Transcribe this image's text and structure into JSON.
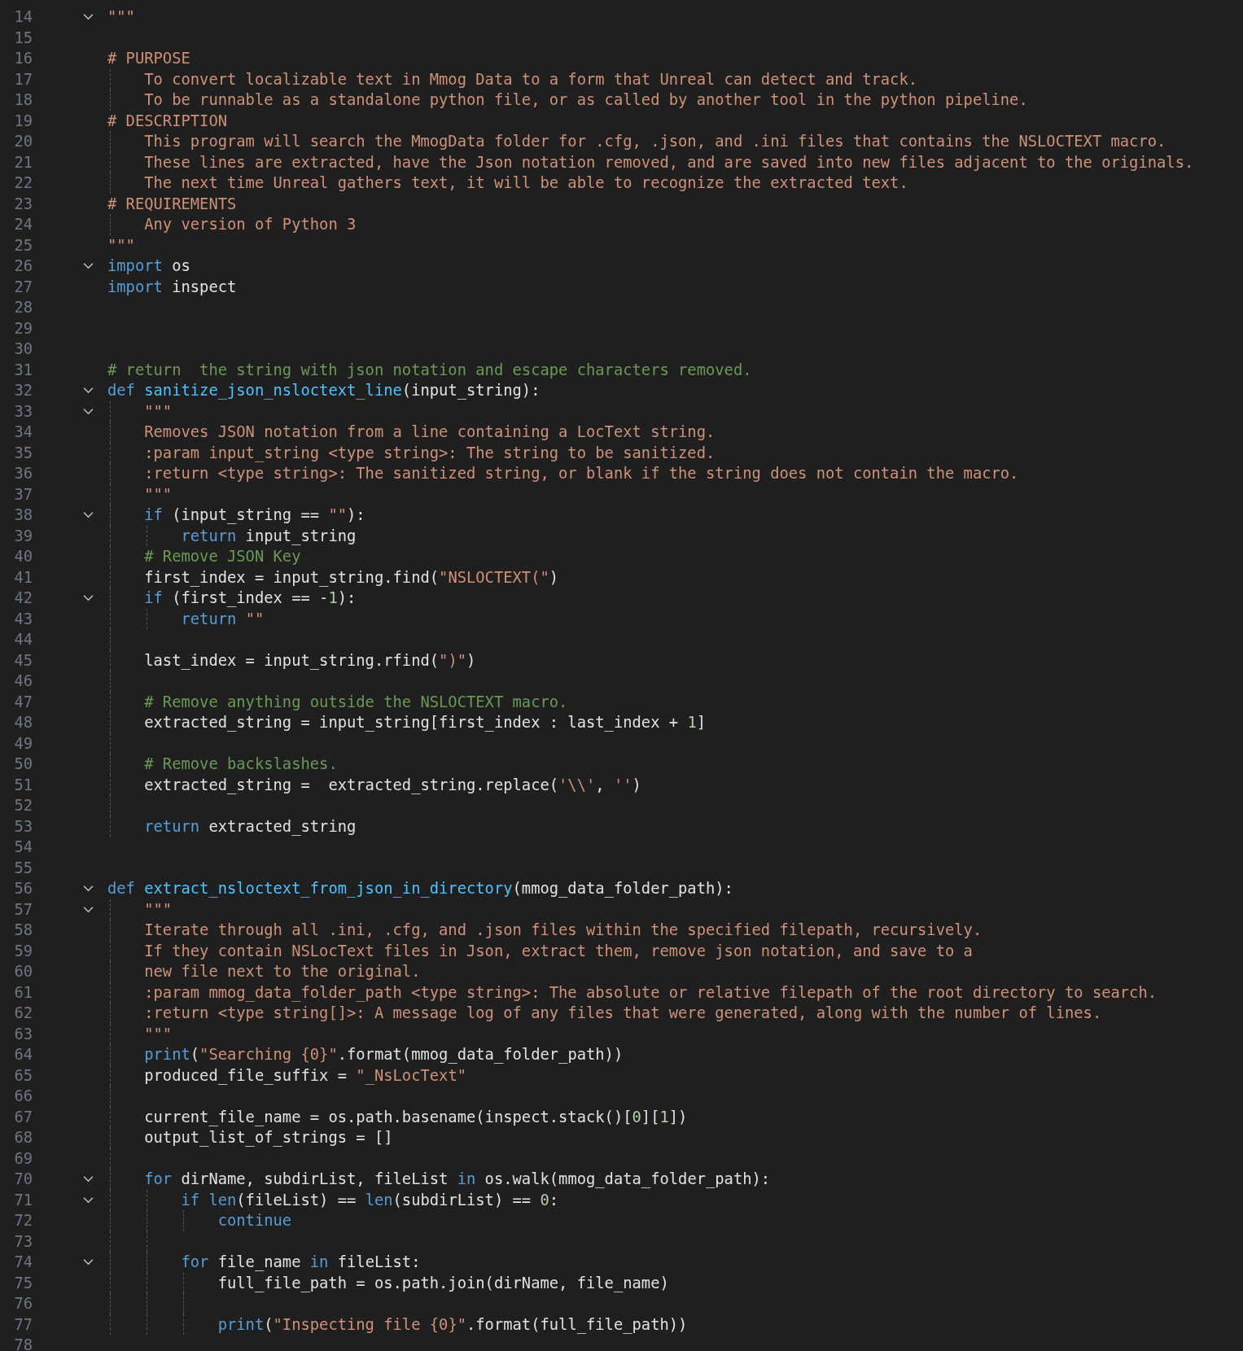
{
  "editor": {
    "lines": [
      {
        "number": "14",
        "folded": false,
        "tokens": [
          {
            "kind": "string",
            "text": "\"\"\""
          }
        ]
      },
      {
        "number": "15"
      },
      {
        "number": "16",
        "tokens": [
          {
            "kind": "string",
            "text": "# PURPOSE"
          }
        ]
      },
      {
        "number": "17",
        "tokens": [
          {
            "kind": "string",
            "text": "    To convert localizable text in Mmog Data to a form that Unreal can detect and track."
          }
        ]
      },
      {
        "number": "18",
        "tokens": [
          {
            "kind": "string",
            "text": "    To be runnable as a standalone python file, or as called by another tool in the python pipeline."
          }
        ]
      },
      {
        "number": "19",
        "tokens": [
          {
            "kind": "string",
            "text": "# DESCRIPTION"
          }
        ]
      },
      {
        "number": "20",
        "tokens": [
          {
            "kind": "string",
            "text": "    This program will search the MmogData folder for .cfg, .json, and .ini files that contains the NSLOCTEXT macro."
          }
        ]
      },
      {
        "number": "21",
        "tokens": [
          {
            "kind": "string",
            "text": "    These lines are extracted, have the Json notation removed, and are saved into new files adjacent to the originals."
          }
        ]
      },
      {
        "number": "22",
        "tokens": [
          {
            "kind": "string",
            "text": "    The next time Unreal gathers text, it will be able to recognize the extracted text."
          }
        ]
      },
      {
        "number": "23",
        "tokens": [
          {
            "kind": "string",
            "text": "# REQUIREMENTS"
          }
        ]
      },
      {
        "number": "24",
        "tokens": [
          {
            "kind": "string",
            "text": "    Any version of Python 3"
          }
        ]
      },
      {
        "number": "25",
        "tokens": [
          {
            "kind": "string",
            "text": "\"\"\""
          }
        ]
      },
      {
        "number": "26",
        "folded": false,
        "tokens": [
          {
            "kind": "keyword",
            "text": "import"
          },
          {
            "kind": "plain",
            "text": " os"
          }
        ]
      },
      {
        "number": "27",
        "tokens": [
          {
            "kind": "keyword",
            "text": "import"
          },
          {
            "kind": "plain",
            "text": " inspect"
          }
        ]
      },
      {
        "number": "28"
      },
      {
        "number": "29"
      },
      {
        "number": "30"
      },
      {
        "number": "31",
        "tokens": [
          {
            "kind": "comment",
            "text": "# return  the string with json notation and escape characters removed."
          }
        ]
      },
      {
        "number": "32",
        "folded": false,
        "tokens": [
          {
            "kind": "keyword",
            "text": "def "
          },
          {
            "kind": "function",
            "text": "sanitize_json_nsloctext_line"
          },
          {
            "kind": "plain",
            "text": "(input_string):"
          }
        ]
      },
      {
        "number": "33",
        "folded": false,
        "tokens": [
          {
            "kind": "string",
            "text": "    \"\"\""
          }
        ]
      },
      {
        "number": "34",
        "tokens": [
          {
            "kind": "string",
            "text": "    Removes JSON notation from a line containing a LocText string."
          }
        ]
      },
      {
        "number": "35",
        "tokens": [
          {
            "kind": "string",
            "text": "    :param input_string <type string>: The string to be sanitized."
          }
        ]
      },
      {
        "number": "36",
        "tokens": [
          {
            "kind": "string",
            "text": "    :return <type string>: The sanitized string, or blank if the string does not contain the macro."
          }
        ]
      },
      {
        "number": "37",
        "tokens": [
          {
            "kind": "string",
            "text": "    \"\"\""
          }
        ]
      },
      {
        "number": "38",
        "folded": false,
        "tokens": [
          {
            "kind": "keyword",
            "text": "    if"
          },
          {
            "kind": "plain",
            "text": " (input_string == "
          },
          {
            "kind": "string",
            "text": "\"\""
          },
          {
            "kind": "plain",
            "text": "):"
          }
        ]
      },
      {
        "number": "39",
        "tokens": [
          {
            "kind": "keyword",
            "text": "        return"
          },
          {
            "kind": "plain",
            "text": " input_string"
          }
        ]
      },
      {
        "number": "40",
        "tokens": [
          {
            "kind": "comment",
            "text": "    # Remove JSON Key"
          }
        ]
      },
      {
        "number": "41",
        "tokens": [
          {
            "kind": "plain",
            "text": "    first_index = input_string.find("
          },
          {
            "kind": "string",
            "text": "\"NSLOCTEXT(\""
          },
          {
            "kind": "plain",
            "text": ")"
          }
        ]
      },
      {
        "number": "42",
        "folded": false,
        "tokens": [
          {
            "kind": "keyword",
            "text": "    if"
          },
          {
            "kind": "plain",
            "text": " (first_index == -"
          },
          {
            "kind": "number",
            "text": "1"
          },
          {
            "kind": "plain",
            "text": "):"
          }
        ]
      },
      {
        "number": "43",
        "tokens": [
          {
            "kind": "keyword",
            "text": "        return "
          },
          {
            "kind": "string",
            "text": "\"\""
          }
        ]
      },
      {
        "number": "44"
      },
      {
        "number": "45",
        "tokens": [
          {
            "kind": "plain",
            "text": "    last_index = input_string.rfind("
          },
          {
            "kind": "string",
            "text": "\")\""
          },
          {
            "kind": "plain",
            "text": ")"
          }
        ]
      },
      {
        "number": "46"
      },
      {
        "number": "47",
        "tokens": [
          {
            "kind": "comment",
            "text": "    # Remove anything outside the NSLOCTEXT macro."
          }
        ]
      },
      {
        "number": "48",
        "tokens": [
          {
            "kind": "plain",
            "text": "    extracted_string = input_string[first_index : last_index + "
          },
          {
            "kind": "number",
            "text": "1"
          },
          {
            "kind": "plain",
            "text": "]"
          }
        ]
      },
      {
        "number": "49"
      },
      {
        "number": "50",
        "tokens": [
          {
            "kind": "comment",
            "text": "    # Remove backslashes."
          }
        ]
      },
      {
        "number": "51",
        "tokens": [
          {
            "kind": "plain",
            "text": "    extracted_string =  extracted_string.replace("
          },
          {
            "kind": "string",
            "text": "'\\\\'"
          },
          {
            "kind": "plain",
            "text": ", "
          },
          {
            "kind": "string",
            "text": "''"
          },
          {
            "kind": "plain",
            "text": ")"
          }
        ]
      },
      {
        "number": "52"
      },
      {
        "number": "53",
        "tokens": [
          {
            "kind": "keyword",
            "text": "    return"
          },
          {
            "kind": "plain",
            "text": " extracted_string"
          }
        ]
      },
      {
        "number": "54"
      },
      {
        "number": "55"
      },
      {
        "number": "56",
        "folded": false,
        "tokens": [
          {
            "kind": "keyword",
            "text": "def "
          },
          {
            "kind": "function",
            "text": "extract_nsloctext_from_json_in_directory"
          },
          {
            "kind": "plain",
            "text": "(mmog_data_folder_path):"
          }
        ]
      },
      {
        "number": "57",
        "folded": false,
        "tokens": [
          {
            "kind": "string",
            "text": "    \"\"\""
          }
        ]
      },
      {
        "number": "58",
        "tokens": [
          {
            "kind": "string",
            "text": "    Iterate through all .ini, .cfg, and .json files within the specified filepath, recursively."
          }
        ]
      },
      {
        "number": "59",
        "tokens": [
          {
            "kind": "string",
            "text": "    If they contain NSLocText files in Json, extract them, remove json notation, and save to a"
          }
        ]
      },
      {
        "number": "60",
        "tokens": [
          {
            "kind": "string",
            "text": "    new file next to the original."
          }
        ]
      },
      {
        "number": "61",
        "tokens": [
          {
            "kind": "string",
            "text": "    :param mmog_data_folder_path <type string>: The absolute or relative filepath of the root directory to search."
          }
        ]
      },
      {
        "number": "62",
        "tokens": [
          {
            "kind": "string",
            "text": "    :return <type string[]>: A message log of any files that were generated, along with the number of lines."
          }
        ]
      },
      {
        "number": "63",
        "tokens": [
          {
            "kind": "string",
            "text": "    \"\"\""
          }
        ]
      },
      {
        "number": "64",
        "tokens": [
          {
            "kind": "builtin",
            "text": "    print"
          },
          {
            "kind": "plain",
            "text": "("
          },
          {
            "kind": "string",
            "text": "\"Searching {0}\""
          },
          {
            "kind": "plain",
            "text": ".format(mmog_data_folder_path))"
          }
        ]
      },
      {
        "number": "65",
        "tokens": [
          {
            "kind": "plain",
            "text": "    produced_file_suffix = "
          },
          {
            "kind": "string",
            "text": "\"_NsLocText\""
          }
        ]
      },
      {
        "number": "66"
      },
      {
        "number": "67",
        "tokens": [
          {
            "kind": "plain",
            "text": "    current_file_name = os.path.basename(inspect.stack()["
          },
          {
            "kind": "number",
            "text": "0"
          },
          {
            "kind": "plain",
            "text": "]["
          },
          {
            "kind": "number",
            "text": "1"
          },
          {
            "kind": "plain",
            "text": "])"
          }
        ]
      },
      {
        "number": "68",
        "tokens": [
          {
            "kind": "plain",
            "text": "    output_list_of_strings = []"
          }
        ]
      },
      {
        "number": "69"
      },
      {
        "number": "70",
        "folded": false,
        "tokens": [
          {
            "kind": "keyword",
            "text": "    for"
          },
          {
            "kind": "plain",
            "text": " dirName, subdirList, fileList "
          },
          {
            "kind": "keyword",
            "text": "in"
          },
          {
            "kind": "plain",
            "text": " os.walk(mmog_data_folder_path):"
          }
        ]
      },
      {
        "number": "71",
        "folded": false,
        "tokens": [
          {
            "kind": "keyword",
            "text": "        if "
          },
          {
            "kind": "builtin",
            "text": "len"
          },
          {
            "kind": "plain",
            "text": "(fileList) == "
          },
          {
            "kind": "builtin",
            "text": "len"
          },
          {
            "kind": "plain",
            "text": "(subdirList) == "
          },
          {
            "kind": "number",
            "text": "0"
          },
          {
            "kind": "plain",
            "text": ":"
          }
        ]
      },
      {
        "number": "72",
        "tokens": [
          {
            "kind": "keyword",
            "text": "            continue"
          }
        ]
      },
      {
        "number": "73"
      },
      {
        "number": "74",
        "folded": false,
        "tokens": [
          {
            "kind": "keyword",
            "text": "        for"
          },
          {
            "kind": "plain",
            "text": " file_name "
          },
          {
            "kind": "keyword",
            "text": "in"
          },
          {
            "kind": "plain",
            "text": " fileList:"
          }
        ]
      },
      {
        "number": "75",
        "tokens": [
          {
            "kind": "plain",
            "text": "            full_file_path = os.path.join(dirName, file_name)"
          }
        ]
      },
      {
        "number": "76"
      },
      {
        "number": "77",
        "tokens": [
          {
            "kind": "builtin",
            "text": "            print"
          },
          {
            "kind": "plain",
            "text": "("
          },
          {
            "kind": "string",
            "text": "\"Inspecting file {0}\""
          },
          {
            "kind": "plain",
            "text": ".format(full_file_path))"
          }
        ]
      },
      {
        "number": "78"
      }
    ]
  }
}
